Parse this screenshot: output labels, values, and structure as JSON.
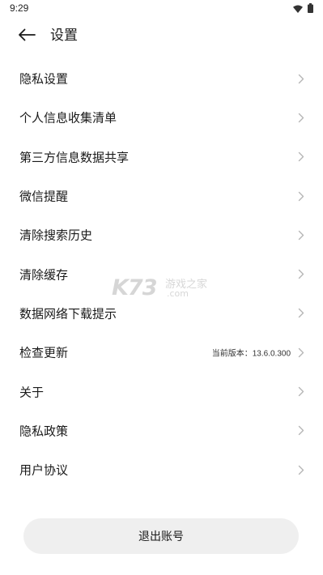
{
  "status_bar": {
    "time": "9:29",
    "icons": [
      "wifi-icon",
      "battery-icon"
    ]
  },
  "header": {
    "back_icon": "arrow-left-icon",
    "title": "设置"
  },
  "settings": {
    "items": [
      {
        "label": "隐私设置"
      },
      {
        "label": "个人信息收集清单"
      },
      {
        "label": "第三方信息数据共享"
      },
      {
        "label": "微信提醒"
      },
      {
        "label": "清除搜索历史"
      },
      {
        "label": "清除缓存"
      },
      {
        "label": "数据网络下载提示"
      },
      {
        "label": "检查更新",
        "value": "当前版本：13.6.0.300"
      },
      {
        "label": "关于"
      },
      {
        "label": "隐私政策"
      },
      {
        "label": "用户协议"
      }
    ]
  },
  "logout": {
    "label": "退出账号"
  },
  "watermark": {
    "logo": "K73",
    "name": "游戏之家",
    "domain": ".com"
  },
  "colors": {
    "text": "#1a1a1a",
    "chevron": "#b5b5b5",
    "button_bg": "#efefef"
  }
}
